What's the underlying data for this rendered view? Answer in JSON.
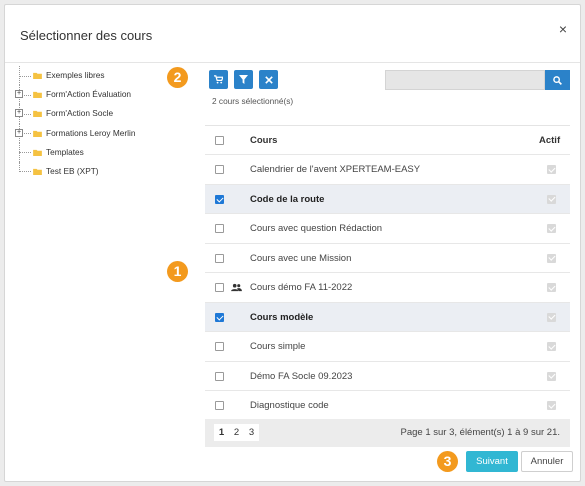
{
  "dialog": {
    "title": "Sélectionner des cours",
    "close_symbol": "×"
  },
  "tree": [
    {
      "label": "Exemples libres",
      "expandable": false
    },
    {
      "label": "Form'Action Évaluation",
      "expandable": true
    },
    {
      "label": "Form'Action Socle",
      "expandable": true
    },
    {
      "label": "Formations Leroy Merlin",
      "expandable": true
    },
    {
      "label": "Templates",
      "expandable": false
    },
    {
      "label": "Test EB (XPT)",
      "expandable": false
    }
  ],
  "badges": {
    "one": "1",
    "two": "2",
    "three": "3"
  },
  "toolbar": {
    "buttons": [
      "cart-icon",
      "filter-icon",
      "clear-icon"
    ],
    "selected_count": "2 cours sélectionné(s)",
    "search_value": "",
    "search_icon": "search-icon"
  },
  "table": {
    "headers": {
      "cours": "Cours",
      "actif": "Actif"
    },
    "rows": [
      {
        "name": "Calendrier de l'avent XPERTEAM-EASY",
        "selected": false,
        "actif": true,
        "icon": ""
      },
      {
        "name": "Code de la route",
        "selected": true,
        "actif": true,
        "icon": ""
      },
      {
        "name": "Cours avec question Rédaction",
        "selected": false,
        "actif": true,
        "icon": ""
      },
      {
        "name": "Cours avec une Mission",
        "selected": false,
        "actif": true,
        "icon": ""
      },
      {
        "name": "Cours démo FA 11-2022",
        "selected": false,
        "actif": true,
        "icon": "users-icon"
      },
      {
        "name": "Cours modèle",
        "selected": true,
        "actif": true,
        "icon": ""
      },
      {
        "name": "Cours simple",
        "selected": false,
        "actif": true,
        "icon": ""
      },
      {
        "name": "Démo FA Socle 09.2023",
        "selected": false,
        "actif": true,
        "icon": ""
      },
      {
        "name": "Diagnostique code",
        "selected": false,
        "actif": true,
        "icon": ""
      }
    ]
  },
  "pager": {
    "pages": [
      "1",
      "2",
      "3"
    ],
    "current": "1",
    "info": "Page 1 sur 3, élément(s) 1 à 9 sur 21."
  },
  "footer": {
    "next_label": "Suivant",
    "cancel_label": "Annuler"
  },
  "colors": {
    "primary": "#2b82c9",
    "accent": "#31b7d3",
    "badge": "#f39a1e",
    "folder": "#f5c242"
  }
}
